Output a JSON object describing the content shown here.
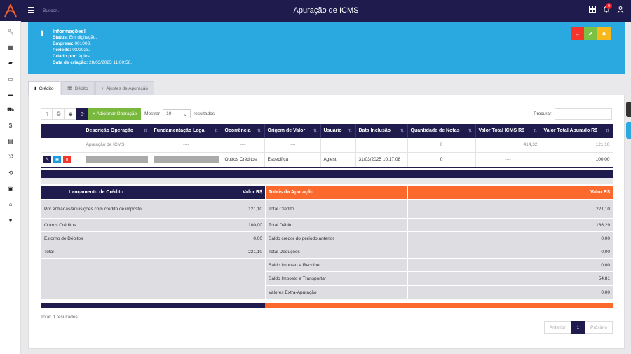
{
  "header": {
    "title": "Apuração de ICMS",
    "search_placeholder": "Buscar...",
    "notification_count": "0"
  },
  "info": {
    "title": "Informações!",
    "lines": [
      {
        "label": "Status:",
        "value": "Em digitação."
      },
      {
        "label": "Empresa:",
        "value": "001003."
      },
      {
        "label": "Período:",
        "value": "03/2025."
      },
      {
        "label": "Criado por:",
        "value": "Agiest."
      },
      {
        "label": "Data de criação:",
        "value": "28/03/2025 11:00:56."
      }
    ],
    "colors": {
      "back": "#f5352b",
      "approve": "#7bc143",
      "lock": "#f8b81b"
    }
  },
  "tabs": [
    "Crédito",
    "Débito",
    "Ajustes de Apuração"
  ],
  "toolbar": {
    "add_label": "Adicionar Operação",
    "show_label": "Mostrar",
    "page_size": "10",
    "results_label": "resultados",
    "search_label": "Procurar:"
  },
  "table": {
    "headers": [
      "Descrição Operação",
      "Fundamentação Legal",
      "Ocorrência",
      "Origem de Valor",
      "Usuário",
      "Data Inclusão",
      "Quantidade de Notas",
      "Valor Total ICMS R$",
      "Valor Total Apurado R$"
    ],
    "summary_row": [
      "Apuração de ICMS",
      "----",
      "----",
      "----",
      "",
      "",
      "0",
      "414,32",
      "121,10"
    ],
    "data_row": [
      "",
      "",
      "Outros Créditos",
      "Especifica",
      "Agiest",
      "31/03/2025 10:17:08",
      "0",
      "----",
      "100,00"
    ]
  },
  "credit_summary": {
    "headers": [
      "Lançamento de Crédito",
      "Valor R$"
    ],
    "rows": [
      [
        "Por entradas/aquisições com crédito de imposto",
        "121,10"
      ],
      [
        "Outros Créditos",
        "100,00"
      ],
      [
        "Estorno de Débitos",
        "0,00"
      ],
      [
        "Total",
        "221,10"
      ]
    ]
  },
  "totals": {
    "headers": [
      "Totais da Apuração",
      "Valor R$"
    ],
    "rows": [
      [
        "Total Crédito",
        "221,10"
      ],
      [
        "Total Débito",
        "166,29"
      ],
      [
        "Saldo credor do período anterior",
        "0,00"
      ],
      [
        "Total Deduções",
        "0,00"
      ],
      [
        "Saldo Imposto a Recolher",
        "0,00"
      ],
      [
        "Saldo Imposto a Transportar",
        "54,81"
      ],
      [
        "Valores Extra-Apuração",
        "0,00"
      ]
    ]
  },
  "footer": {
    "total_results": "Total: 1 resultados",
    "prev": "Anterior",
    "page": "1",
    "next": "Próximo"
  }
}
